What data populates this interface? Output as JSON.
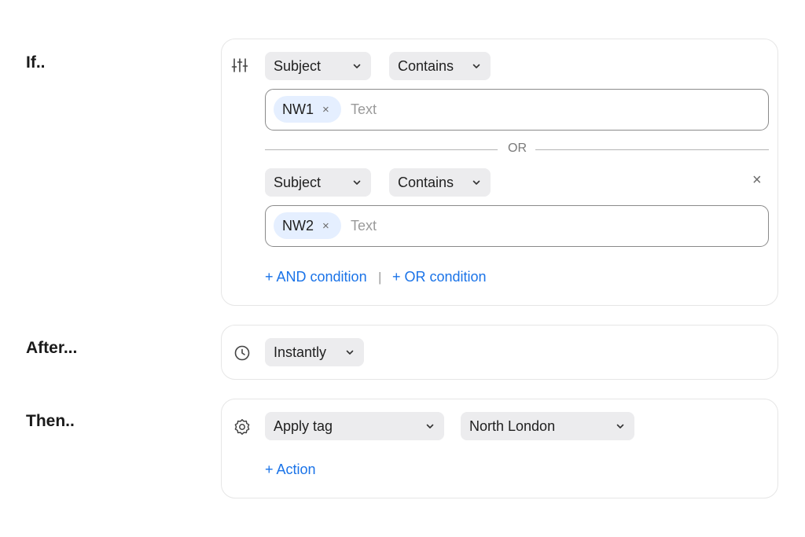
{
  "if_section": {
    "label": "If..",
    "filter_icon": "sliders-icon",
    "conditions": [
      {
        "field": "Subject",
        "operator": "Contains",
        "tag": "NW1",
        "placeholder": "Text"
      },
      {
        "field": "Subject",
        "operator": "Contains",
        "tag": "NW2",
        "placeholder": "Text"
      }
    ],
    "or_divider": "OR",
    "remove_symbol": "×",
    "chip_remove_symbol": "×",
    "and_condition_link": "+ AND condition",
    "link_separator": "|",
    "or_condition_link": "+ OR condition"
  },
  "after_section": {
    "label": "After...",
    "icon": "clock-icon",
    "timing": "Instantly"
  },
  "then_section": {
    "label": "Then..",
    "icon": "gear-icon",
    "action": "Apply tag",
    "tag_value": "North London",
    "add_action_link": "+ Action"
  },
  "colors": {
    "accent": "#1a73e8",
    "dropdown_bg": "#ececee",
    "chip_bg": "#e5efff",
    "card_border": "#e6e6e6"
  }
}
